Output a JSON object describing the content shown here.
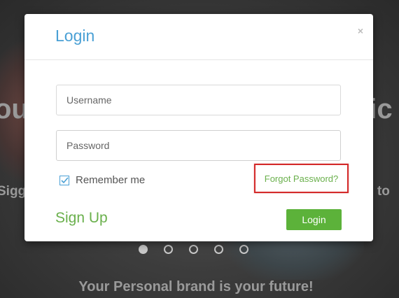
{
  "background": {
    "heading_left": "ou",
    "heading_right_accent": "l",
    "heading_right": " ic",
    "subheading_left": "Sigg",
    "subheading_right": "d to",
    "carousel": {
      "dot_count": 5,
      "active_index": 0
    },
    "tagline": "Your Personal brand is your future!"
  },
  "modal": {
    "title": "Login",
    "close_label": "×",
    "username": {
      "placeholder": "Username",
      "value": ""
    },
    "password": {
      "placeholder": "Password",
      "value": ""
    },
    "remember_me": {
      "label": "Remember me",
      "checked": true
    },
    "forgot_password_label": "Forgot Password?",
    "signup_label": "Sign Up",
    "login_button_label": "Login"
  },
  "colors": {
    "title_blue": "#4aa0d5",
    "link_green": "#6ab04c",
    "button_green": "#5cb23a",
    "highlight_red": "#d42a2a"
  }
}
